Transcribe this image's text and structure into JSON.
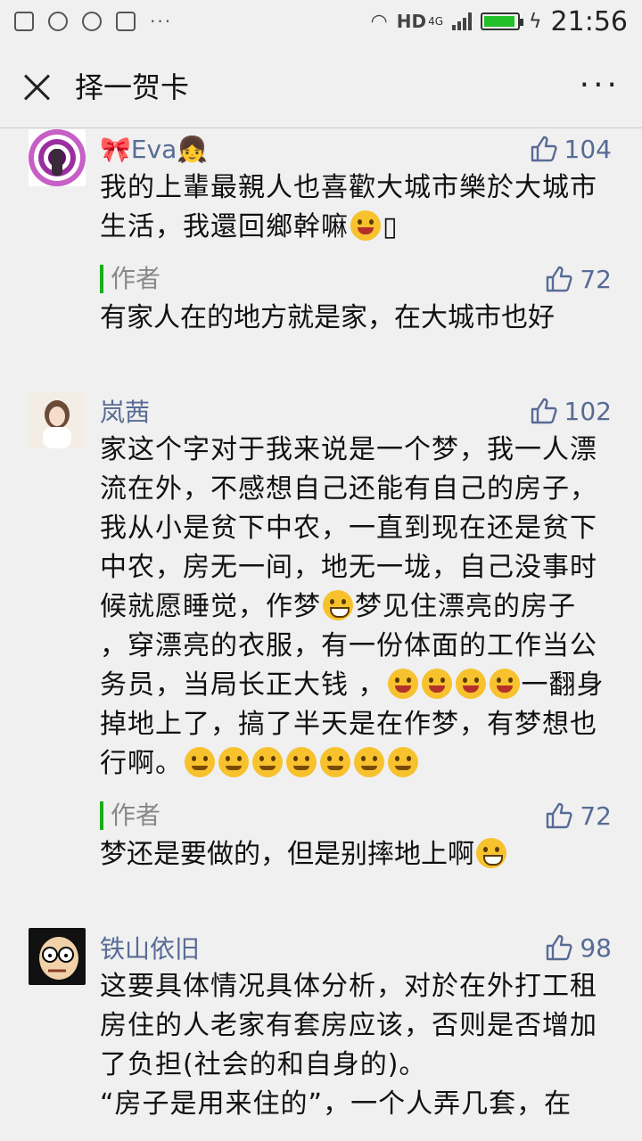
{
  "status_bar": {
    "network": "HD",
    "network_type": "4G",
    "time": "21:56",
    "battery_level": 0.95
  },
  "header": {
    "title": "择一贺卡",
    "close_icon": "close-icon",
    "more_icon": "more-icon"
  },
  "comments": [
    {
      "name": "🎀Eva👧",
      "likes": "104",
      "text": "我的上輩最親人也喜歡大城市樂於大城市生活，我還回鄉幹嘛",
      "author_label": "作者",
      "author_likes": "72",
      "reply": "有家人在的地方就是家，在大城市也好"
    },
    {
      "name": "岚茜",
      "likes": "102",
      "text_part1": "家这个字对于我来说是一个梦，我一人漂流在外，不感想自己还能有自己的房子，我从小是贫下中农，一直到现在还是贫下中农，房无一间，地无一垅，自己没事时候就愿睡觉，作梦",
      "text_part2": "梦见住漂亮的房子 ，穿漂亮的衣服，有一份体面的工作当公务员，当局长正大钱 ，",
      "text_part3": "一翻身掉地上了，搞了半天是在作梦，有梦想也行啊。",
      "author_label": "作者",
      "author_likes": "72",
      "reply": "梦还是要做的，但是别摔地上啊"
    },
    {
      "name": "铁山依旧",
      "likes": "98",
      "text": "这要具体情况具体分析，对於在外打工租房住的人老家有套房应该，否则是否增加了负担(社会的和自身的)。",
      "text2": "“房子是用来住的”，一个人弄几套，在"
    }
  ]
}
